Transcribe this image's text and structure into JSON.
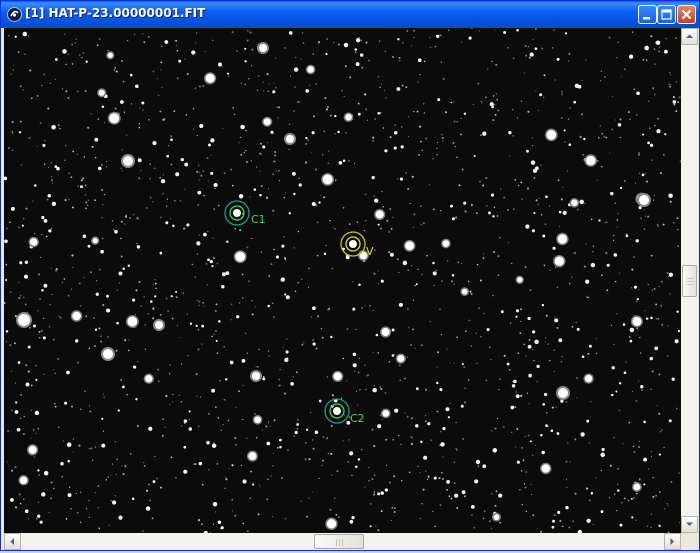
{
  "window": {
    "title": "[1] HAT-P-23.00000001.FIT"
  },
  "title_buttons": {
    "minimize": "minimize-icon",
    "maximize": "maximize-icon",
    "close": "close-icon"
  },
  "markers": [
    {
      "label": "C1",
      "color": "#33e04a",
      "ring_color": "#1a9a9a"
    },
    {
      "label": "V",
      "color": "#e8e02a",
      "ring_color": "#c8c020"
    },
    {
      "label": "C2",
      "color": "#33e04a",
      "ring_color": "#1a9a9a"
    }
  ],
  "colors": {
    "titlebar": "#0a5ff0",
    "image_background": "#0b0b0b",
    "comparison_marker": "#33e04a",
    "variable_marker": "#e8e02a"
  }
}
